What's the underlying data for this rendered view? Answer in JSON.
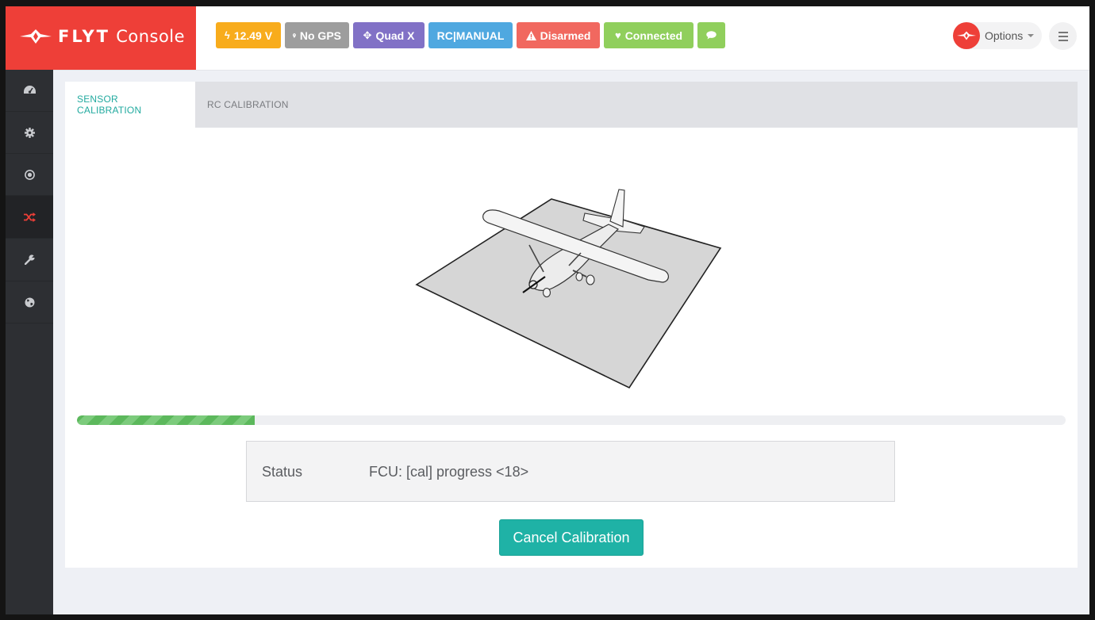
{
  "header": {
    "brand": {
      "name_bold": "FLYT",
      "name_light": "Console",
      "logo_icon": "flyt-logo-icon",
      "background": "#ee3f38"
    },
    "badges": [
      {
        "icon": "bolt-icon",
        "glyph": "ϟ",
        "label": "12.49 V",
        "color": "#f8ac1c"
      },
      {
        "icon": "map-marker-icon",
        "glyph": "⬤",
        "label": "No GPS",
        "color": "#9d9d9d"
      },
      {
        "icon": "arrows-icon",
        "glyph": "✥",
        "label": "Quad X",
        "color": "#8171c6"
      },
      {
        "icon": "",
        "glyph": "",
        "label": "RC|MANUAL",
        "color": "#4fa8e0"
      },
      {
        "icon": "warning-icon",
        "glyph": "▲",
        "label": "Disarmed",
        "color": "#f1685f"
      },
      {
        "icon": "heart-icon",
        "glyph": "♥",
        "label": "Connected",
        "color": "#90cf5c"
      },
      {
        "icon": "comments-icon",
        "glyph": "💬",
        "label": "",
        "color": "#90cf5c"
      }
    ],
    "options_label": "Options"
  },
  "sidebar": {
    "items": [
      {
        "name": "sidebar-item-dashboard",
        "icon": "dashboard-icon",
        "active": false
      },
      {
        "name": "sidebar-item-settings",
        "icon": "gear-icon",
        "active": false
      },
      {
        "name": "sidebar-item-target",
        "icon": "target-icon",
        "active": false
      },
      {
        "name": "sidebar-item-calibration",
        "icon": "shuffle-icon",
        "active": true
      },
      {
        "name": "sidebar-item-tools",
        "icon": "wrench-icon",
        "active": false
      },
      {
        "name": "sidebar-item-globe",
        "icon": "globe-icon",
        "active": false
      }
    ]
  },
  "tabs": [
    {
      "label": "SENSOR CALIBRATION",
      "active": true
    },
    {
      "label": "RC CALIBRATION",
      "active": false
    }
  ],
  "calibration": {
    "progress_percent": 18,
    "status_label": "Status",
    "status_value": "FCU: [cal] progress <18>",
    "cancel_label": "Cancel Calibration"
  }
}
